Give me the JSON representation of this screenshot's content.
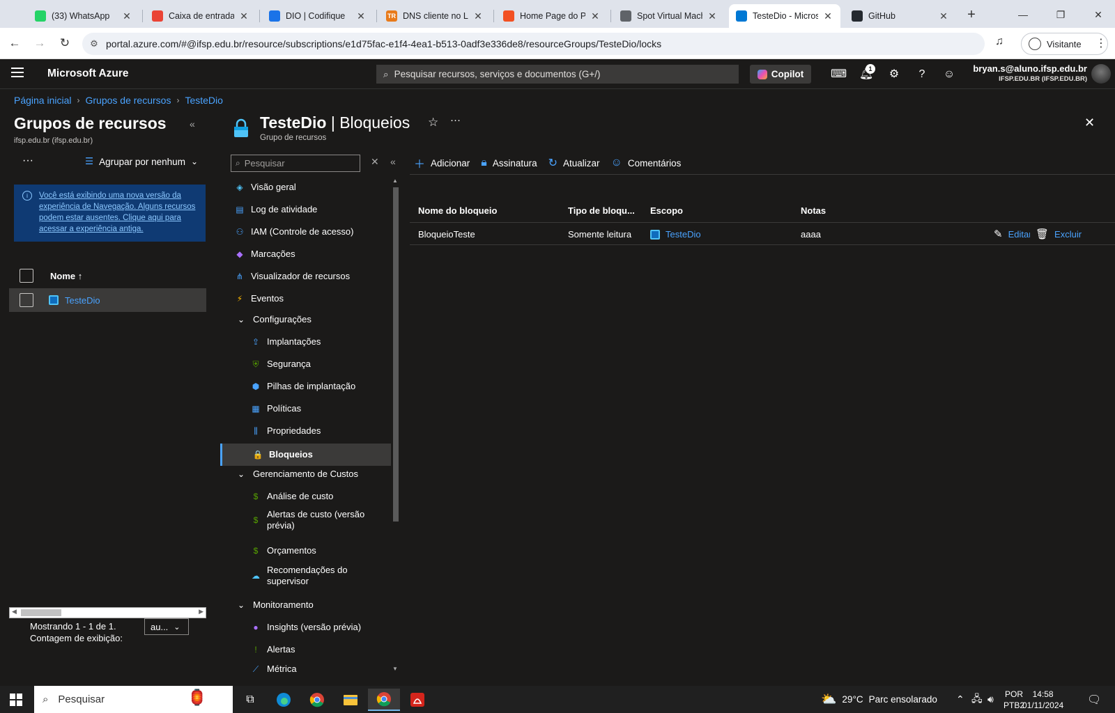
{
  "browser": {
    "tabs": [
      {
        "title": "(33) WhatsApp",
        "icon": "whatsapp-icon",
        "color": "#25d366"
      },
      {
        "title": "Caixa de entrada (",
        "icon": "gmail-icon",
        "color": "#ea4335"
      },
      {
        "title": "DIO | Codifique",
        "icon": "dio-icon",
        "color": "#1a73e8"
      },
      {
        "title": "DNS cliente no Lin",
        "icon": "tr-icon",
        "color": "#e87a1a",
        "glyph": "TR"
      },
      {
        "title": "Home Page do Po",
        "icon": "microsoft-icon",
        "color": "#f25022"
      },
      {
        "title": "Spot Virtual Mach",
        "icon": "globe-icon",
        "color": "#5f6368"
      },
      {
        "title": "TesteDio - Microsc",
        "icon": "azure-icon",
        "color": "#0078d4"
      },
      {
        "title": "GitHub",
        "icon": "github-icon",
        "color": "#24292f"
      }
    ],
    "url": "portal.azure.com/#@ifsp.edu.br/resource/subscriptions/e1d75fac-e1f4-4ea1-b513-0adf3e336de8/resourceGroups/TesteDio/locks",
    "profile_label": "Visitante"
  },
  "azure": {
    "brand": "Microsoft Azure",
    "search_placeholder": "Pesquisar recursos, serviços e documentos (G+/)",
    "copilot_label": "Copilot",
    "notification_count": "1",
    "user_email": "bryan.s@aluno.ifsp.edu.br",
    "user_org": "IFSP.EDU.BR (IFSP.EDU.BR)"
  },
  "breadcrumb": [
    "Página inicial",
    "Grupos de recursos",
    "TesteDio"
  ],
  "left_pane": {
    "title": "Grupos de recursos",
    "subtitle": "ifsp.edu.br (ifsp.edu.br)",
    "more": "···",
    "group_by": "Agrupar por nenhum",
    "info": "Você está exibindo uma nova versão da experiência de Navegação. Alguns recursos podem estar ausentes. Clique aqui para acessar a experiência antiga.",
    "column_name": "Nome ↑",
    "rows": [
      "TesteDio"
    ],
    "count_text_1": "Mostrando 1 - 1 de 1.",
    "count_text_2": "Contagem de exibição:",
    "page_size": "au..."
  },
  "blade": {
    "title_resource": "TesteDio",
    "title_sep": " | ",
    "title_page": "Bloqueios",
    "subtitle": "Grupo de recursos",
    "menu_search_placeholder": "Pesquisar",
    "menu": [
      {
        "label": "Visão geral",
        "kind": "top",
        "icon": "overview-icon",
        "color": "#4fc3f7",
        "glyph": "◈"
      },
      {
        "label": "Log de atividade",
        "kind": "top",
        "icon": "activity-log-icon",
        "color": "#4aa3ff",
        "glyph": "▤"
      },
      {
        "label": "IAM (Controle de acesso)",
        "kind": "top",
        "icon": "iam-icon",
        "color": "#4aa3ff",
        "glyph": "⚇"
      },
      {
        "label": "Marcações",
        "kind": "top",
        "icon": "tag-icon",
        "color": "#a970ff",
        "glyph": "◆"
      },
      {
        "label": "Visualizador de recursos",
        "kind": "top",
        "icon": "resource-visualizer-icon",
        "color": "#4aa3ff",
        "glyph": "⋔"
      },
      {
        "label": "Eventos",
        "kind": "top",
        "icon": "events-icon",
        "color": "#ffb900",
        "glyph": "⚡"
      },
      {
        "label": "Configurações",
        "kind": "grp",
        "icon": "chevron-down-icon",
        "color": "#ffffff",
        "glyph": "⌄"
      },
      {
        "label": "Implantações",
        "kind": "sub",
        "icon": "deployments-icon",
        "color": "#4aa3ff",
        "glyph": "⇪"
      },
      {
        "label": "Segurança",
        "kind": "sub",
        "icon": "security-shield-icon",
        "color": "#57a300",
        "glyph": "⛨"
      },
      {
        "label": "Pilhas de implantação",
        "kind": "sub",
        "icon": "deployment-stacks-icon",
        "color": "#4aa3ff",
        "glyph": "⬢"
      },
      {
        "label": "Políticas",
        "kind": "sub",
        "icon": "policies-icon",
        "color": "#4aa3ff",
        "glyph": "▦"
      },
      {
        "label": "Propriedades",
        "kind": "sub",
        "icon": "properties-icon",
        "color": "#4aa3ff",
        "glyph": "⫼"
      },
      {
        "label": "Bloqueios",
        "kind": "sub",
        "icon": "lock-icon",
        "color": "#4fc3f7",
        "glyph": "🔒",
        "selected": true
      },
      {
        "label": "Gerenciamento de Custos",
        "kind": "grp",
        "icon": "chevron-down-icon",
        "color": "#ffffff",
        "glyph": "⌄"
      },
      {
        "label": "Análise de custo",
        "kind": "sub",
        "icon": "cost-analysis-icon",
        "color": "#57a300",
        "glyph": "$"
      },
      {
        "label": "Alertas de custo (versão prévia)",
        "kind": "sub",
        "icon": "cost-alerts-icon",
        "color": "#57a300",
        "glyph": "$"
      },
      {
        "label": "Orçamentos",
        "kind": "sub",
        "icon": "budgets-icon",
        "color": "#57a300",
        "glyph": "$"
      },
      {
        "label": "Recomendações do supervisor",
        "kind": "sub",
        "icon": "advisor-icon",
        "color": "#4fc3f7",
        "glyph": "☁"
      },
      {
        "label": "Monitoramento",
        "kind": "grp",
        "icon": "chevron-down-icon",
        "color": "#ffffff",
        "glyph": "⌄"
      },
      {
        "label": "Insights (versão prévia)",
        "kind": "sub",
        "icon": "insights-icon",
        "color": "#a970ff",
        "glyph": "●"
      },
      {
        "label": "Alertas",
        "kind": "sub",
        "icon": "alerts-icon",
        "color": "#57a300",
        "glyph": "!"
      },
      {
        "label": "Métrica",
        "kind": "sub",
        "icon": "metrics-icon",
        "color": "#4aa3ff",
        "glyph": "⟋"
      }
    ],
    "toolbar": {
      "add": "Adicionar",
      "subscription": "Assinatura",
      "refresh": "Atualizar",
      "feedback": "Comentários"
    },
    "grid": {
      "headers": [
        "Nome do bloqueio",
        "Tipo de bloqu...",
        "Escopo",
        "Notas"
      ],
      "rows": [
        {
          "name": "BloqueioTeste",
          "type": "Somente leitura",
          "scope": "TesteDio",
          "notes": "aaaa",
          "edit": "Editar",
          "delete": "Excluir"
        }
      ]
    }
  },
  "taskbar": {
    "search_placeholder": "Pesquisar",
    "weather_temp": "29°C",
    "weather_text": "Parc ensolarado",
    "lang_1": "POR",
    "lang_2": "PTB2",
    "time": "14:58",
    "date": "01/11/2024"
  }
}
